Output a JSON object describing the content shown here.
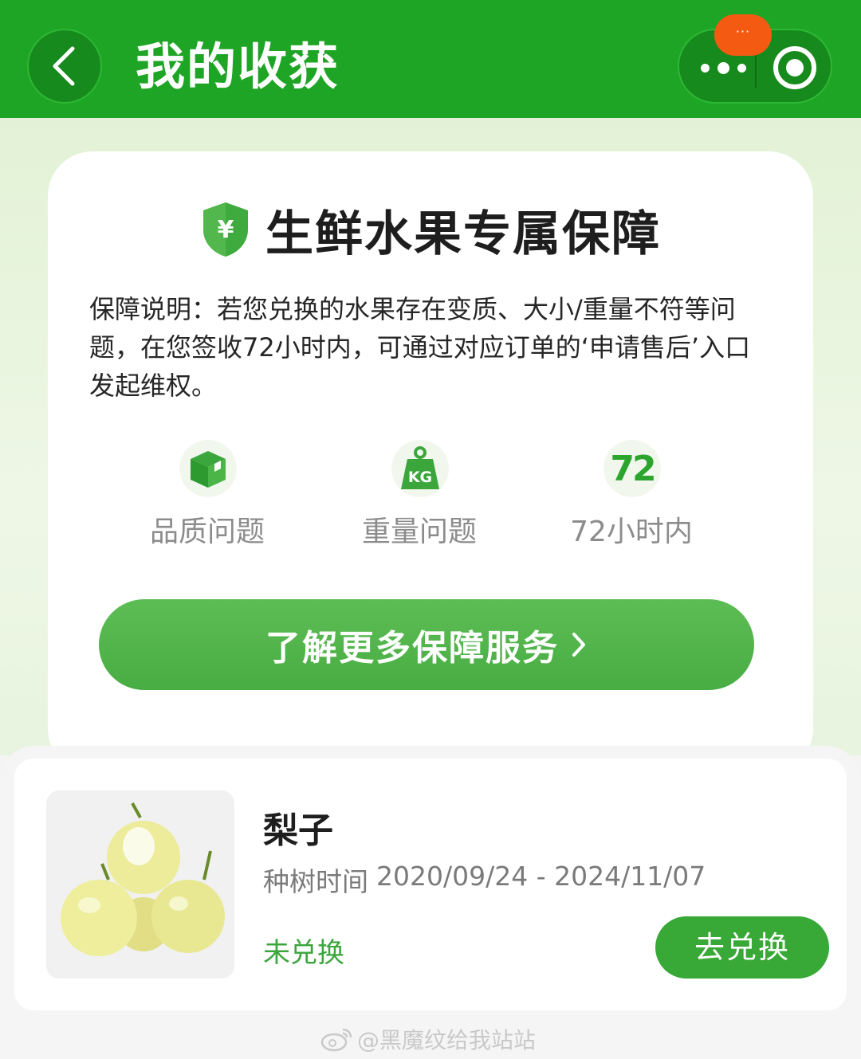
{
  "header": {
    "title": "我的收获",
    "badge_text": "···",
    "back_icon": "chevron-left-icon",
    "more_icon": "more-dots-icon",
    "record_icon": "target-circle-icon",
    "bg_color": "#1fa526"
  },
  "guarantee": {
    "title": "生鲜水果专属保障",
    "shield_symbol": "¥",
    "description": "保障说明：若您兑换的水果存在变质、大小/重量不符等问题，在您签收72小时内，可通过对应订单的‘申请售后’入口发起维权。",
    "features": [
      {
        "label": "品质问题",
        "icon": "box-icon"
      },
      {
        "label": "重量问题",
        "icon": "weight-kg-icon",
        "icon_text": "KG"
      },
      {
        "label": "72小时内",
        "icon": "number-72-icon",
        "icon_text": "72"
      }
    ],
    "more_button_label": "了解更多保障服务",
    "accent_color": "#2ca52e"
  },
  "product": {
    "name": "梨子",
    "plant_time_label": "种树时间",
    "plant_time_range": "2020/09/24 - 2024/11/07",
    "status": "未兑换",
    "redeem_button_label": "去兑换"
  },
  "watermark": {
    "text": "@黑魔纹给我站站",
    "icon": "weibo-icon"
  }
}
